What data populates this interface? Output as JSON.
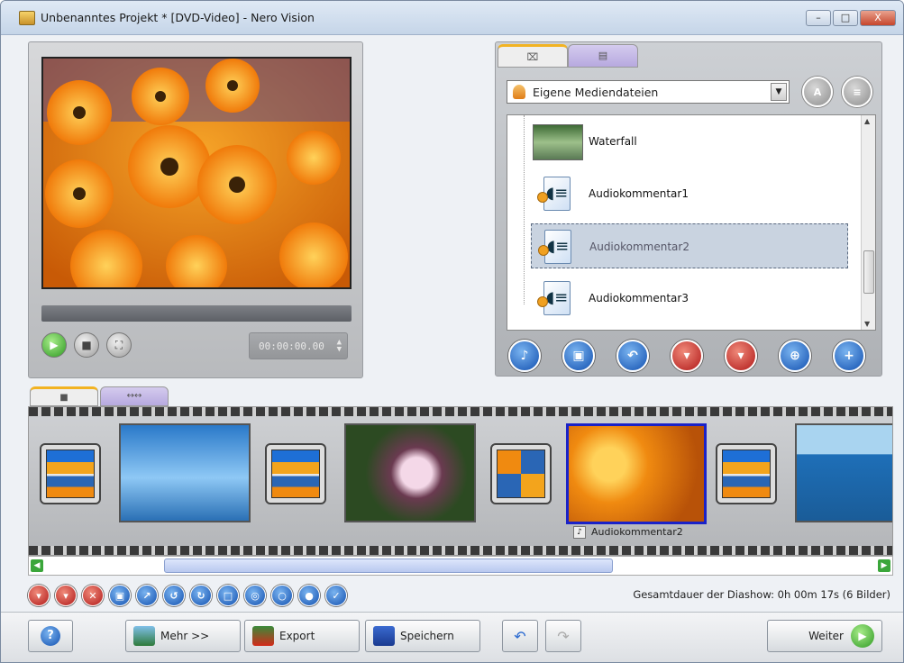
{
  "window": {
    "title": "Unbenanntes Projekt * [DVD-Video] - Nero Vision",
    "minimize": "–",
    "maximize": "□",
    "close": "X"
  },
  "preview": {
    "timecode": "00:00:00.00"
  },
  "media": {
    "tabs": [
      "⌧",
      "▤"
    ],
    "source_select": "Eigene Mediendateien",
    "round_buttons": [
      "A",
      "≡"
    ],
    "items": [
      {
        "label": "Waterfall",
        "kind": "image"
      },
      {
        "label": "Audiokommentar1",
        "kind": "audio"
      },
      {
        "label": "Audiokommentar2",
        "kind": "audio",
        "selected": true
      },
      {
        "label": "Audiokommentar3",
        "kind": "audio"
      }
    ]
  },
  "storyboard": {
    "tabs": [
      "■",
      "↔↔"
    ],
    "selected_caption": "Audiokommentar2"
  },
  "status": {
    "total_duration": "Gesamtdauer der Diashow: 0h 00m 17s (6 Bilder)"
  },
  "bottom": {
    "help": "?",
    "more": "Mehr >>",
    "export": "Export",
    "save": "Speichern",
    "next": "Weiter"
  }
}
